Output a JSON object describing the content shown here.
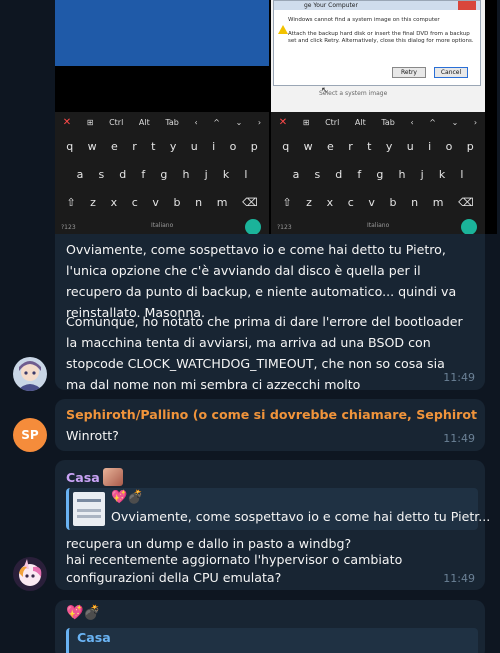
{
  "photo": {
    "dialog_title": "ge Your Computer",
    "dialog_message": "Windows cannot find a system image on this computer\n\nAttach the backup hard disk or insert the final DVD from a backup set and click Retry. Alternatively, close this dialog for more options.",
    "retry_label": "Retry",
    "cancel_label": "Cancel",
    "select_hint": "Select a system image",
    "keyboard_toolbar": [
      "✕",
      "⊞",
      "Ctrl",
      "Alt",
      "Tab",
      "‹",
      "^",
      "⌄",
      "›"
    ],
    "keyboard_row1": [
      "q",
      "w",
      "e",
      "r",
      "t",
      "y",
      "u",
      "i",
      "o",
      "p"
    ],
    "keyboard_row2": [
      "a",
      "s",
      "d",
      "f",
      "g",
      "h",
      "j",
      "k",
      "l"
    ],
    "keyboard_row3": [
      "⇧",
      "z",
      "x",
      "c",
      "v",
      "b",
      "n",
      "m",
      "⌫"
    ],
    "keyboard_numkey": "?123",
    "keyboard_lang": "Italiano"
  },
  "messages": [
    {
      "paragraph1": "Ovviamente, come sospettavo io e come hai detto tu Pietro, l'unica opzione che c'è avviando dal disco è quella per il recupero da punto di backup, e niente automatico... quindi va reinstallato. Masonna.",
      "paragraph2": "Comunque, ho notato che prima di dare l'errore del bootloader la macchina tenta di avviarsi, ma arriva ad una BSOD con stopcode CLOCK_WATCHDOG_TIMEOUT, che non so cosa sia ma dal nome non mi sembra ci azzecchi molto",
      "time": "11:49"
    },
    {
      "avatar_initials": "SP",
      "sender": "Sephiroth/Pallino (o come si dovrebbe chiamare, Sephiroth + Pa...",
      "text": "Winrott?",
      "time": "11:49"
    },
    {
      "sender": "Casa",
      "reply_emoji": "💖💣",
      "reply_text": "Ovviamente, come sospettavo io e come hai detto tu Pietr...",
      "line1": "recupera un dump e dallo in pasto a windbg?",
      "line2": "hai recentemente aggiornato l'hypervisor o cambiato configurazioni della CPU emulata?",
      "time": "11:49"
    },
    {
      "emoji": "💖💣",
      "reply_sender": "Casa"
    }
  ],
  "colors": {
    "background": "#0e1621",
    "bubble": "#182533",
    "time": "#6b8196",
    "sender_sp": "#f0943b",
    "sender_casa": "#c9a3f5",
    "avatar_sp": "#f58c3b",
    "reply_accent": "#6ab3f3"
  }
}
